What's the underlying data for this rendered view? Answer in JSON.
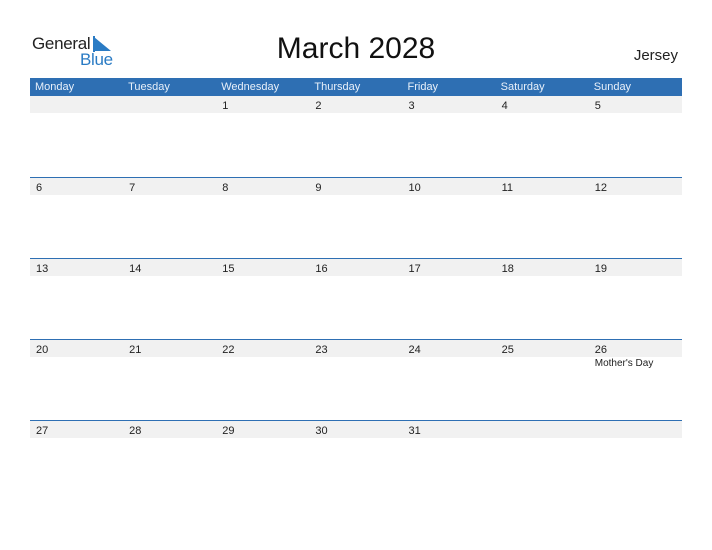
{
  "logo": {
    "line1": "General",
    "line2": "Blue"
  },
  "title": "March 2028",
  "country": "Jersey",
  "colors": {
    "header_bg": "#2e6fb3",
    "accent": "#2a7bc4",
    "strip_bg": "#f1f1f1"
  },
  "days": [
    "Monday",
    "Tuesday",
    "Wednesday",
    "Thursday",
    "Friday",
    "Saturday",
    "Sunday"
  ],
  "weeks": [
    [
      "",
      "",
      "1",
      "2",
      "3",
      "4",
      "5"
    ],
    [
      "6",
      "7",
      "8",
      "9",
      "10",
      "11",
      "12"
    ],
    [
      "13",
      "14",
      "15",
      "16",
      "17",
      "18",
      "19"
    ],
    [
      "20",
      "21",
      "22",
      "23",
      "24",
      "25",
      "26"
    ],
    [
      "27",
      "28",
      "29",
      "30",
      "31",
      "",
      ""
    ]
  ],
  "events": {
    "3": {
      "6": "Mother's Day"
    }
  }
}
